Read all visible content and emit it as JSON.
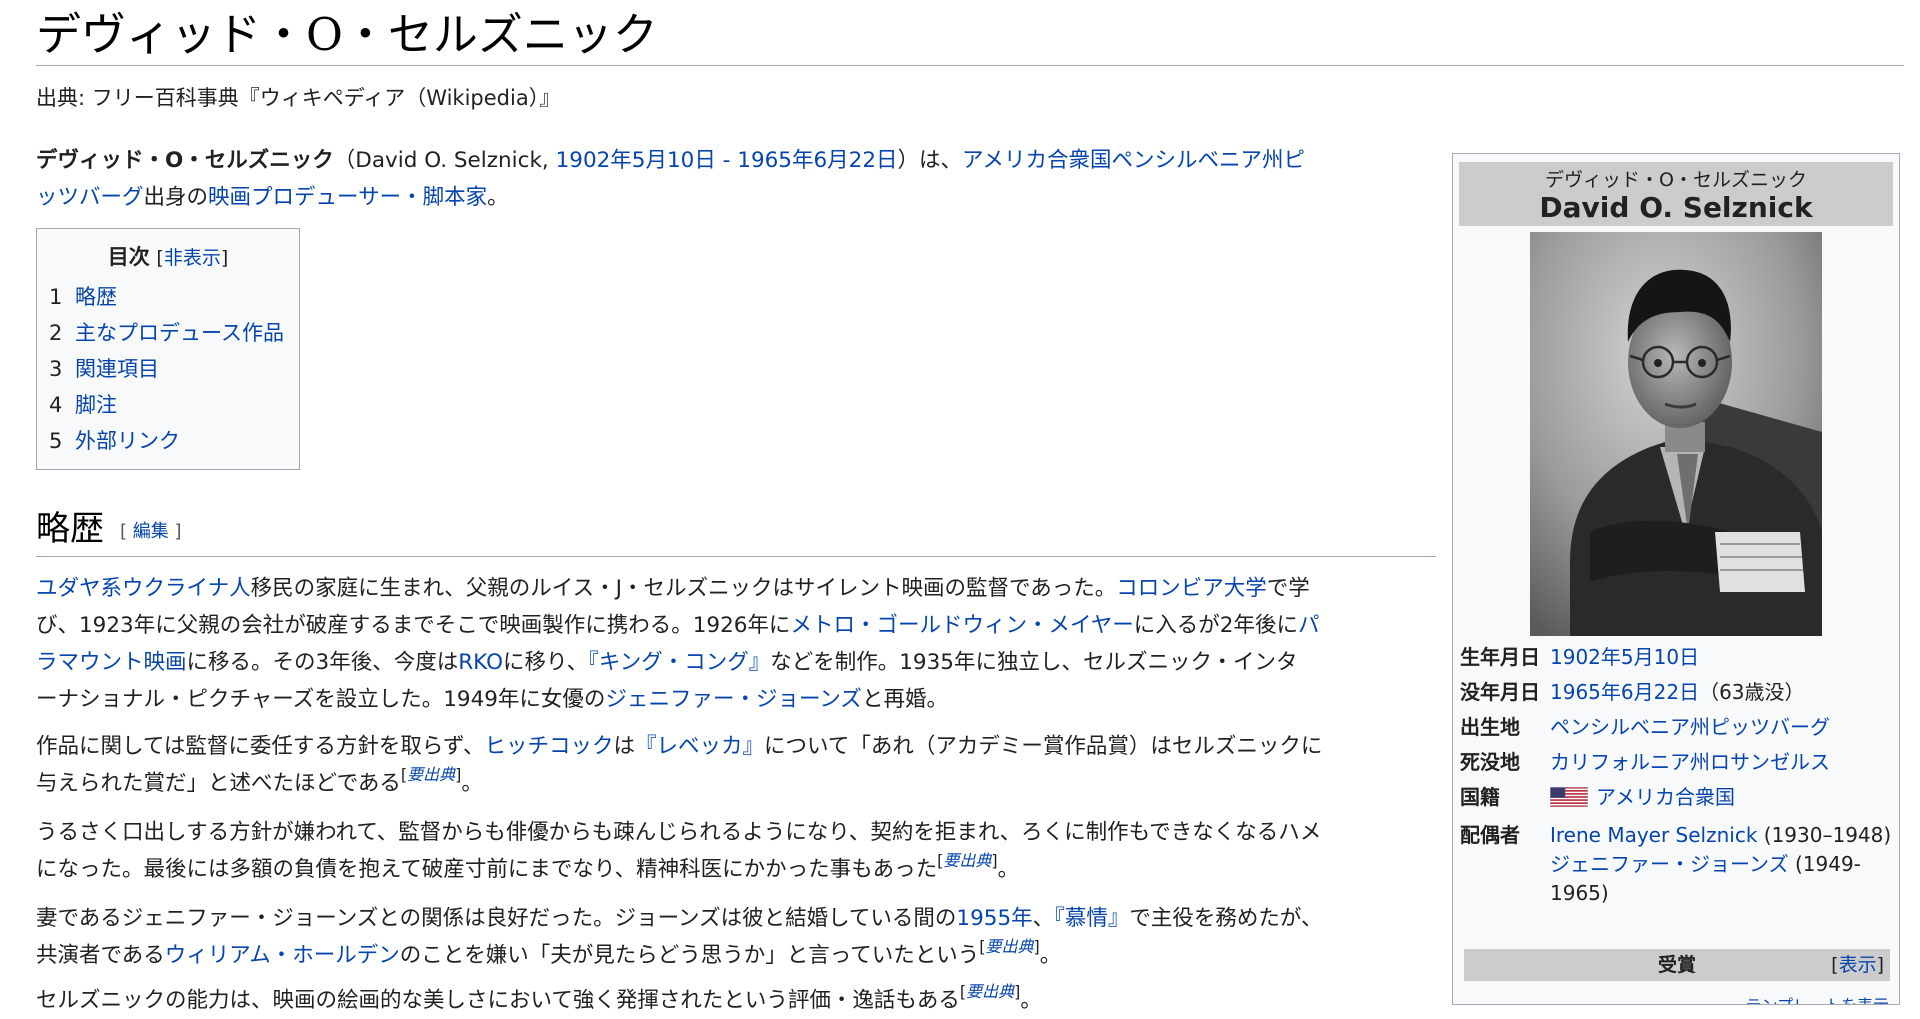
{
  "article": {
    "title": "デヴィッド・O・セルズニック",
    "tagline": "出典: フリー百科事典『ウィキペディア（Wikipedia）』"
  },
  "lead": {
    "bold_name": "デヴィッド・O・セルズニック",
    "t1": "（David O. Selznick, ",
    "dates_link": "1902年5月10日 - 1965年6月22日",
    "t2": "）は、",
    "place_link": "アメリカ合衆国ペンシルベニア州ピ",
    "place_link2": "ッツバーグ",
    "t3": "出身の",
    "job_link": "映画プロデューサー・脚本家",
    "t4": "。"
  },
  "toc": {
    "heading": "目次",
    "toggle_open": "[",
    "toggle": "非表示",
    "toggle_close": "]",
    "items": [
      {
        "num": "1",
        "label": "略歴"
      },
      {
        "num": "2",
        "label": "主なプロデュース作品"
      },
      {
        "num": "3",
        "label": "関連項目"
      },
      {
        "num": "4",
        "label": "脚注"
      },
      {
        "num": "5",
        "label": "外部リンク"
      }
    ]
  },
  "section": {
    "heading": "略歴",
    "edit_open": "[ ",
    "edit": "編集",
    "edit_close": " ]"
  },
  "p1": {
    "l1_a": "ユダヤ系ウクライナ人",
    "l1_b": "移民の家庭に生まれ、父親のルイス・J・セルズニックはサイレント映画の監督であった。",
    "l1_c": "コロンビア大学",
    "l1_d": "で学",
    "l2_a": "び、1923年に父親の会社が破産するまでそこで映画製作に携わる。1926年に",
    "l2_b": "メトロ・ゴールドウィン・メイヤー",
    "l2_c": "に入るが2年後に",
    "l2_d": "パ",
    "l3_a": "ラマウント映画",
    "l3_b": "に移る。その3年後、今度は",
    "l3_c": "RKO",
    "l3_d": "に移り、",
    "l3_e": "『キング・コング』",
    "l3_f": "などを制作。1935年に独立し、セルズニック・インタ",
    "l4_a": "ーナショナル・ピクチャーズを設立した。1949年に女優の",
    "l4_b": "ジェニファー・ジョーンズ",
    "l4_c": "と再婚。"
  },
  "p2": {
    "l1_a": "作品に関しては監督に委任する方針を取らず、",
    "l1_b": "ヒッチコック",
    "l1_c": "は",
    "l1_d": "『レベッカ』",
    "l1_e": "について「あれ（アカデミー賞作品賞）はセルズニックに",
    "l2_a": "与えられた賞だ」と述べたほどである",
    "ref": "要出典",
    "l2_b": "。"
  },
  "p3": {
    "l1": "うるさく口出しする方針が嫌われて、監督からも俳優からも疎んじられるようになり、契約を拒まれ、ろくに制作もできなくなるハメ",
    "l2_a": "になった。最後には多額の負債を抱えて破産寸前にまでなり、精神科医にかかった事もあった",
    "ref": "要出典",
    "l2_b": "。"
  },
  "p4": {
    "l1_a": "妻であるジェニファー・ジョーンズとの関係は良好だった。ジョーンズは彼と結婚している間の",
    "l1_b": "1955年",
    "l1_c": "、",
    "l1_d": "『慕情』",
    "l1_e": "で主役を務めたが、",
    "l2_a": "共演者である",
    "l2_b": "ウィリアム・ホールデン",
    "l2_c": "のことを嫌い「夫が見たらどう思うか」と言っていたという",
    "ref": "要出典",
    "l2_d": "。"
  },
  "p5": {
    "l1_a": "セルズニックの能力は、映画の絵画的な美しさにおいて強く発揮されたという評価・逸話もある",
    "ref": "要出典",
    "l1_b": "。"
  },
  "ref_open": "[",
  "ref_close": "]",
  "infobox": {
    "name_jp": "デヴィッド・O・セルズニック",
    "name_en": "David O. Selznick",
    "rows": {
      "birth_k": "生年月日",
      "birth_v": "1902年5月10日",
      "death_k": "没年月日",
      "death_v": "1965年6月22日",
      "death_age": "（63歳没）",
      "birthplace_k": "出生地",
      "birthplace_v": "ペンシルベニア州ピッツバーグ",
      "deathplace_k": "死没地",
      "deathplace_v": "カリフォルニア州ロサンゼルス",
      "nationality_k": "国籍",
      "nationality_v": "アメリカ合衆国",
      "spouse_k": "配偶者",
      "spouse1": "Irene Mayer Selznick",
      "spouse1_years": " (1930–1948)",
      "spouse2": "ジェニファー・ジョーンズ",
      "spouse2_years": " (1949-1965)"
    },
    "awards_title": "受賞",
    "awards_toggle_open": "[",
    "awards_toggle": "表示",
    "awards_toggle_close": "]",
    "template_link": "テンプレートを表示"
  },
  "colors": {
    "link": "#0645ad",
    "text": "#202122",
    "infobox_bg": "#f8f9fa",
    "header_bg": "#cccccc"
  }
}
